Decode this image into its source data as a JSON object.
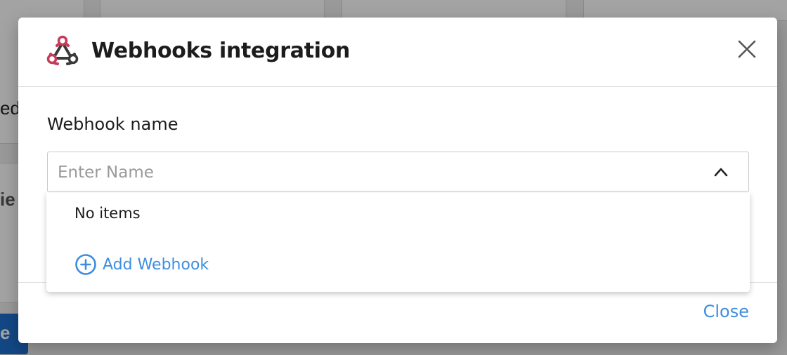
{
  "background": {
    "partial_text_1": "ed",
    "partial_text_2": "ie",
    "partial_button_label": "e"
  },
  "modal": {
    "title": "Webhooks integration",
    "logo_icon": "webhook-icon",
    "close_icon": "close-icon",
    "field": {
      "label": "Webhook name",
      "placeholder": "Enter Name",
      "value": "",
      "toggle_icon": "chevron-up-icon"
    },
    "dropdown": {
      "empty_text": "No items",
      "add_label": "Add Webhook",
      "add_icon": "plus-circle-icon"
    },
    "footer": {
      "close_label": "Close"
    }
  },
  "colors": {
    "accent": "#3d8ee0",
    "logo_red": "#c73a5a",
    "logo_dark": "#3a3a3a",
    "background_button": "#1e6fd0"
  }
}
